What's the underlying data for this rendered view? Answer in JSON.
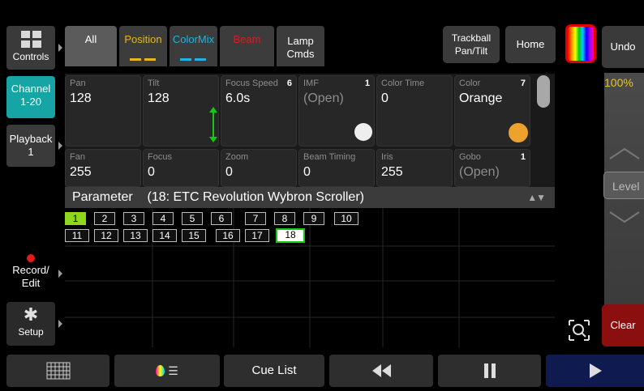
{
  "sidebar": {
    "controls": "Controls",
    "channel_line1": "Channel",
    "channel_line2": "1-20",
    "playback_line1": "Playback",
    "playback_line2": "1",
    "record_line1": "Record/",
    "record_line2": "Edit",
    "setup": "Setup"
  },
  "tabs": [
    {
      "label": "All",
      "color": "#ffffff"
    },
    {
      "label": "Position",
      "color": "#e8b71c"
    },
    {
      "label": "ColorMix",
      "color": "#1fb3e0"
    },
    {
      "label": "Beam",
      "color": "#e01b1b"
    },
    {
      "label_line1": "Lamp",
      "label_line2": "Cmds",
      "color": "#ffffff"
    }
  ],
  "top_right": {
    "trackball_line1": "Trackball",
    "trackball_line2": "Pan/Tilt",
    "home": "Home",
    "undo": "Undo"
  },
  "params_row1": [
    {
      "label": "Pan",
      "value": "128",
      "num": ""
    },
    {
      "label": "Tilt",
      "value": "128",
      "num": ""
    },
    {
      "label": "Focus Speed",
      "value": "6.0s",
      "num": "6"
    },
    {
      "label": "IMF",
      "value": "(Open)",
      "num": "1"
    },
    {
      "label": "Color Time",
      "value": "0",
      "num": ""
    },
    {
      "label": "Color",
      "value": "Orange",
      "num": "7"
    }
  ],
  "params_row2": [
    {
      "label": "Fan",
      "value": "255",
      "num": ""
    },
    {
      "label": "Focus",
      "value": "0",
      "num": ""
    },
    {
      "label": "Zoom",
      "value": "0",
      "num": ""
    },
    {
      "label": "Beam Timing",
      "value": "0",
      "num": ""
    },
    {
      "label": "Iris",
      "value": "255",
      "num": ""
    },
    {
      "label": "Gobo",
      "value": "(Open)",
      "num": "1"
    }
  ],
  "parameter_header": {
    "label": "Parameter",
    "device": "(18: ETC Revolution Wybron Scroller)"
  },
  "channels_row1": [
    "1",
    "2",
    "3",
    "4",
    "5",
    "6",
    "7",
    "8",
    "9",
    "10"
  ],
  "channels_row2": [
    "11",
    "12",
    "13",
    "14",
    "15",
    "16",
    "17",
    "18"
  ],
  "fader": {
    "level_text": "100%",
    "label": "Level"
  },
  "clear": "Clear",
  "bottom": {
    "cue_list": "Cue List"
  },
  "colors": {
    "accent_teal": "#17a4a4",
    "selected_green": "#8fd61c",
    "clear_red": "#8b0f0f",
    "imf_white": "#eeeeee",
    "color_orange": "#eda22b",
    "play_blue": "#0f1a4f"
  }
}
